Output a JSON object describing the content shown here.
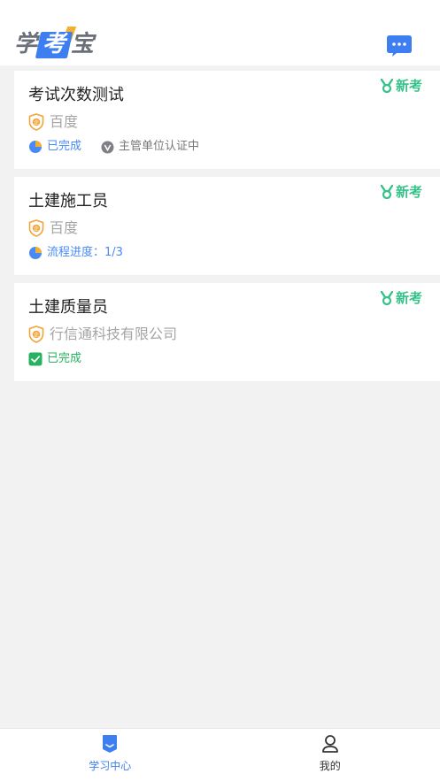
{
  "app": {
    "logo": [
      "学",
      "考",
      "宝"
    ]
  },
  "header": {
    "message_icon": "chat-bubble-icon"
  },
  "colors": {
    "accent": "#3d7ef0",
    "new_tag": "#35c28a",
    "company_shield": "#f0a53a",
    "progress_blue": "#4a8af4",
    "done_green": "#27b25f"
  },
  "cards": [
    {
      "title": "考试次数测试",
      "tag": "新考",
      "company": "百度",
      "statuses": [
        {
          "icon": "pie-progress-icon",
          "text": "已完成"
        },
        {
          "icon": "verified-badge-icon",
          "text": "主管单位认证中"
        }
      ]
    },
    {
      "title": "土建施工员",
      "tag": "新考",
      "company": "百度",
      "statuses": [
        {
          "icon": "pie-progress-icon",
          "text": "流程进度：1/3"
        }
      ]
    },
    {
      "title": "土建质量员",
      "tag": "新考",
      "company": "行信通科技有限公司",
      "statuses": [
        {
          "icon": "checkbox-checked-icon",
          "text": "已完成"
        }
      ]
    }
  ],
  "tabbar": {
    "items": [
      {
        "label": "学习中心",
        "icon": "study-center-icon",
        "active": true
      },
      {
        "label": "我的",
        "icon": "user-icon",
        "active": false
      }
    ]
  }
}
